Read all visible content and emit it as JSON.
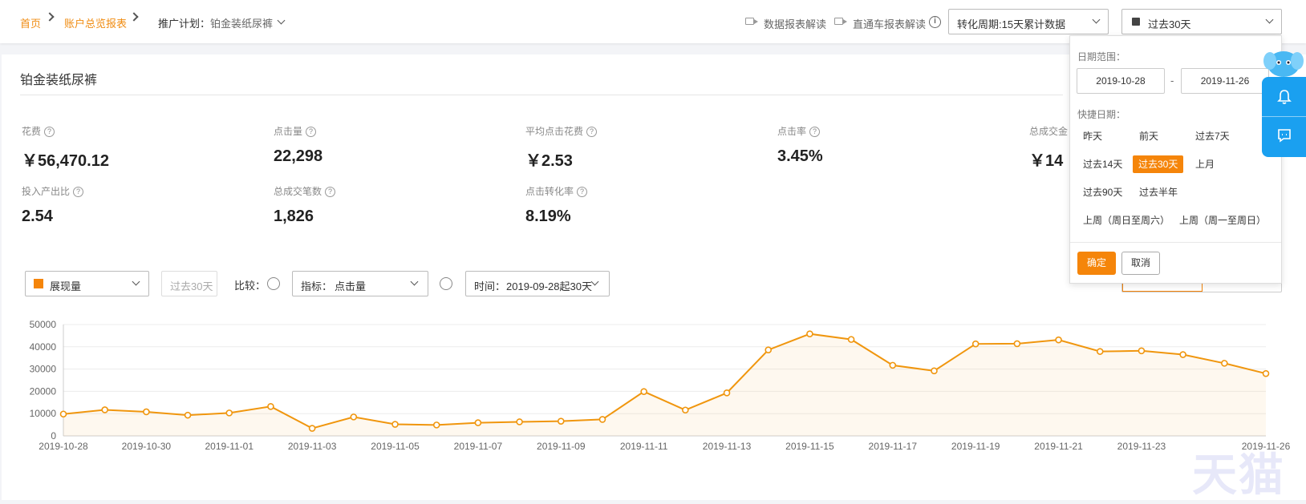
{
  "breadcrumb": {
    "home": "首页",
    "report": "账户总览报表",
    "plan_label": "推广计划：",
    "plan_value": "铂金装纸尿裤"
  },
  "toplinks": {
    "data_report": "数据报表解读",
    "ztc_report": "直通车报表解读",
    "cycle_select": "转化周期:15天累计数据",
    "date_select": "过去30天"
  },
  "page_title": "铂金装纸尿裤",
  "kpis": [
    {
      "label": "花费",
      "value": "￥56,470.12"
    },
    {
      "label": "点击量",
      "value": "22,298"
    },
    {
      "label": "平均点击花费",
      "value": "￥2.53"
    },
    {
      "label": "点击率",
      "value": "3.45%"
    },
    {
      "label": "总成交金",
      "value": "￥14"
    },
    {
      "label": "投入产出比",
      "value": "2.54"
    },
    {
      "label": "总成交笔数",
      "value": "1,826"
    },
    {
      "label": "点击转化率",
      "value": "8.19%"
    }
  ],
  "controls": {
    "metric_select": "展现量",
    "range_tag": "过去30天",
    "compare_label": "比较：",
    "index_label": "指标：",
    "index_value": "点击量",
    "time_label": "时间：",
    "time_value": "2019-09-28起30天"
  },
  "datepicker": {
    "range_label": "日期范围：",
    "start": "2019-10-28",
    "sep": "-",
    "end": "2019-11-26",
    "quick_label": "快捷日期：",
    "quick": [
      "昨天",
      "前天",
      "过去7天",
      "过去14天",
      "过去30天",
      "上月",
      "过去90天",
      "过去半年",
      "上周（周日至周六）",
      "上周（周一至周日）"
    ],
    "active": "过去30天",
    "ok": "确定",
    "cancel": "取消"
  },
  "watermark": "天猫",
  "colors": {
    "accent": "#f5850a",
    "link": "#f08c12",
    "float": "#1aa0f0"
  },
  "chart_data": {
    "type": "area",
    "series": [
      {
        "name": "展现量",
        "values": [
          9800,
          11700,
          10800,
          9300,
          10300,
          13200,
          3400,
          8500,
          5200,
          4900,
          5900,
          6300,
          6600,
          7400,
          19900,
          11600,
          19300,
          38600,
          45800,
          43300,
          31700,
          29200,
          41300,
          41400,
          43100,
          37900,
          38200,
          36500,
          32600,
          28000
        ]
      }
    ],
    "x": [
      "2019-10-28",
      "2019-10-29",
      "2019-10-30",
      "2019-10-31",
      "2019-11-01",
      "2019-11-02",
      "2019-11-03",
      "2019-11-04",
      "2019-11-05",
      "2019-11-06",
      "2019-11-07",
      "2019-11-08",
      "2019-11-09",
      "2019-11-10",
      "2019-11-11",
      "2019-11-12",
      "2019-11-13",
      "2019-11-14",
      "2019-11-15",
      "2019-11-16",
      "2019-11-17",
      "2019-11-18",
      "2019-11-19",
      "2019-11-20",
      "2019-11-21",
      "2019-11-22",
      "2019-11-23",
      "2019-11-24",
      "2019-11-25",
      "2019-11-26"
    ],
    "xtick_labels": [
      "2019-10-28",
      "2019-10-30",
      "2019-11-01",
      "2019-11-03",
      "2019-11-05",
      "2019-11-07",
      "2019-11-09",
      "2019-11-11",
      "2019-11-13",
      "2019-11-15",
      "2019-11-17",
      "2019-11-19",
      "2019-11-21",
      "2019-11-23",
      "2019-11-26"
    ],
    "yticks": [
      0,
      10000,
      20000,
      30000,
      40000,
      50000
    ],
    "ylim": [
      0,
      50000
    ],
    "grid": true,
    "color": "#f0960e"
  }
}
